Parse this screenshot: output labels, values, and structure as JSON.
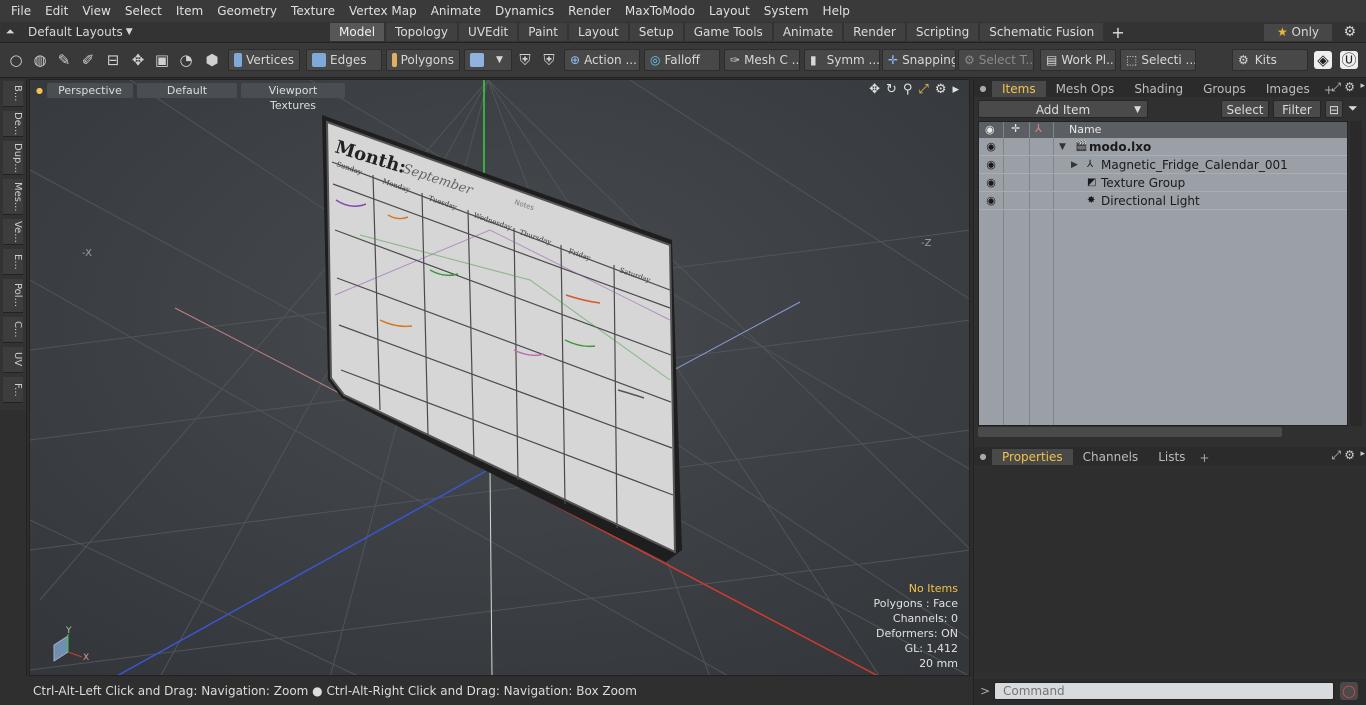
{
  "menu": [
    "File",
    "Edit",
    "View",
    "Select",
    "Item",
    "Geometry",
    "Texture",
    "Vertex Map",
    "Animate",
    "Dynamics",
    "Render",
    "MaxToModo",
    "Layout",
    "System",
    "Help"
  ],
  "layout": {
    "selector": "Default Layouts",
    "tabs": [
      "Model",
      "Topology",
      "UVEdit",
      "Paint",
      "Layout",
      "Setup",
      "Game Tools",
      "Animate",
      "Render",
      "Scripting",
      "Schematic Fusion"
    ],
    "active_tab": "Model",
    "only_label": "Only"
  },
  "toolbar": {
    "vertices": "Vertices",
    "edges": "Edges",
    "polygons": "Polygons",
    "action": "Action ...",
    "falloff": "Falloff",
    "meshc": "Mesh C ...",
    "symm": "Symm ...",
    "snapping": "Snapping",
    "selectt": "Select T...",
    "workpl": "Work Pl...",
    "selecti": "Selecti ...",
    "kits": "Kits"
  },
  "leftstrip": [
    "B...",
    "De...",
    "Dup...",
    "Mes...",
    "Ve...",
    "E...",
    "Pol...",
    "C...",
    "UV",
    "F..."
  ],
  "viewport": {
    "perspective": "Perspective",
    "default": "Default",
    "textures": "Viewport Textures",
    "stats": {
      "items": "No Items",
      "polygons": "Polygons : Face",
      "channels": "Channels: 0",
      "deformers": "Deformers: ON",
      "gl": "GL: 1,412",
      "scale": "20 mm"
    },
    "axis_x": "X",
    "axis_y": "Y",
    "axis_neg_x": "-X",
    "axis_neg_z": "-Z"
  },
  "calendar": {
    "title": "Month:",
    "month": "September",
    "notes": "Notes",
    "days": [
      "Sunday",
      "Monday",
      "Tuesday",
      "Wednesday",
      "Thursday",
      "Friday",
      "Saturday"
    ]
  },
  "status": "Ctrl-Alt-Left Click and Drag: Navigation: Zoom ● Ctrl-Alt-Right Click and Drag: Navigation: Box Zoom",
  "items_panel": {
    "tabs": [
      "Items",
      "Mesh Ops",
      "Shading",
      "Groups",
      "Images"
    ],
    "active_tab": "Items",
    "add_item": "Add Item",
    "select": "Select",
    "filter": "Filter",
    "col_name": "Name",
    "rows": [
      {
        "name": "modo.lxo",
        "indent": 0
      },
      {
        "name": "Magnetic_Fridge_Calendar_001",
        "indent": 1
      },
      {
        "name": "Texture Group",
        "indent": 1
      },
      {
        "name": "Directional Light",
        "indent": 1
      }
    ]
  },
  "props_panel": {
    "tabs": [
      "Properties",
      "Channels",
      "Lists"
    ],
    "active_tab": "Properties"
  },
  "command": {
    "placeholder": "Command"
  },
  "colors": {
    "accent": "#f2c34a",
    "x_axis": "#d13a2f",
    "y_axis": "#3ad13a",
    "z_axis": "#3a55d1"
  }
}
